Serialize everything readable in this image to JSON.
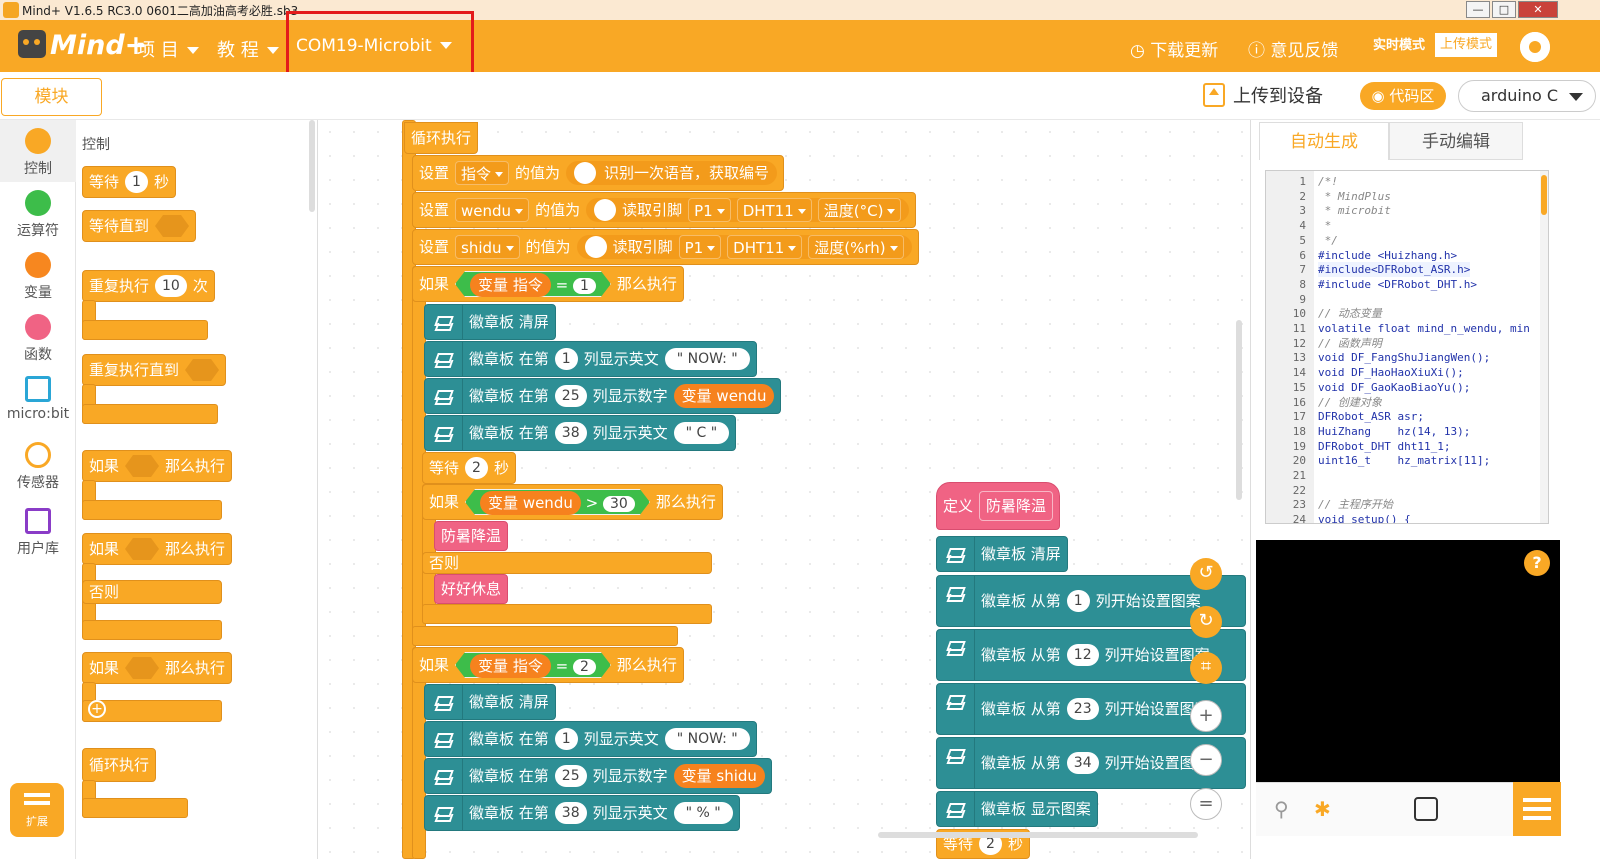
{
  "window": {
    "title": "Mind+ V1.6.5 RC3.0   0601二高加油高考必胜.sb3"
  },
  "menubar": {
    "logo": "Mind+",
    "project": "项 目",
    "tutorial": "教 程",
    "port": "COM19-Microbit",
    "download_update": "下载更新",
    "feedback": "意见反馈",
    "realtime_mode": "实时模式",
    "upload_mode": "上传模式"
  },
  "toolbar": {
    "modules_tab": "模块",
    "upload_to_device": "上传到设备",
    "code_area": "代码区",
    "language": "arduino C"
  },
  "categories": [
    "控制",
    "运算符",
    "变量",
    "函数",
    "micro:bit",
    "传感器",
    "用户库"
  ],
  "extension": "扩展",
  "palette": {
    "title": "控制",
    "wait": "等待",
    "wait_val": "1",
    "seconds": "秒",
    "wait_until": "等待直到",
    "repeat": "重复执行",
    "repeat_val": "10",
    "times": "次",
    "repeat_until": "重复执行直到",
    "if": "如果",
    "then": "那么执行",
    "else": "否则",
    "forever": "循环执行"
  },
  "script": {
    "forever": "循环执行",
    "set": "设置",
    "value_of": "的值为",
    "var_cmd": "指令",
    "var_wendu": "wendu",
    "var_shidu": "shidu",
    "asr": "识别一次语音，获取编号",
    "read_pin": "读取引脚",
    "pin": "P1",
    "dht": "DHT11",
    "temp_c": "温度(°C)",
    "hum": "湿度(%rh)",
    "if": "如果",
    "then": "那么执行",
    "else": "否则",
    "variable": "变量",
    "eq": "=",
    "gt": ">",
    "one": "1",
    "two": "2",
    "thirty": "30",
    "badge_clear": "徽章板 清屏",
    "badge_at": "徽章板 在第",
    "col_text": "列显示英文",
    "col_num": "列显示数字",
    "c1": "1",
    "c25": "25",
    "c38": "38",
    "now": "\" NOW: \"",
    "cdeg": "\" C \"",
    "pct": "\" % \"",
    "wait": "等待",
    "sec2": "2",
    "seconds": "秒",
    "cool": "防暑降温",
    "rest": "好好休息"
  },
  "define": {
    "label": "定义",
    "name": "防暑降温",
    "clear": "徽章板 清屏",
    "from": "徽章板 从第",
    "set_pattern": "列开始设置图案",
    "c1": "1",
    "c12": "12",
    "c23": "23",
    "c34": "34",
    "show": "徽章板 显示图案",
    "wait": "等待",
    "sec2": "2",
    "seconds": "秒"
  },
  "zoom": {
    "reset": "="
  },
  "right_panel": {
    "auto_tab": "自动生成",
    "manual_tab": "手动编辑",
    "code_lines": [
      "/*!",
      " * MindPlus",
      " * microbit",
      " *",
      " */",
      "#include <Huizhang.h>",
      "#include<DFRobot_ASR.h>",
      "#include <DFRobot_DHT.h>",
      "",
      "// 动态变量",
      "volatile float mind_n_wendu, min",
      "// 函数声明",
      "void DF_FangShuJiangWen();",
      "void DF_HaoHaoXiuXi();",
      "void DF_GaoKaoBiaoYu();",
      "// 创建对象",
      "DFRobot_ASR asr;",
      "HuiZhang    hz(14, 13);",
      "DFRobot_DHT dht11_1;",
      "uint16_t    hz_matrix[11];",
      "",
      "",
      "// 主程序开始",
      "void setup() {"
    ],
    "line_numbers": [
      "1",
      "2",
      "3",
      "4",
      "5",
      "6",
      "7",
      "8",
      "9",
      "10",
      "11",
      "12",
      "13",
      "14",
      "15",
      "16",
      "17",
      "18",
      "19",
      "20",
      "21",
      "22",
      "23",
      "24"
    ],
    "help": "?"
  },
  "colors": {
    "accent": "#f9a825",
    "badge_block": "#2d8f95",
    "function_block": "#f06384",
    "highlight": "#e31b1b"
  }
}
